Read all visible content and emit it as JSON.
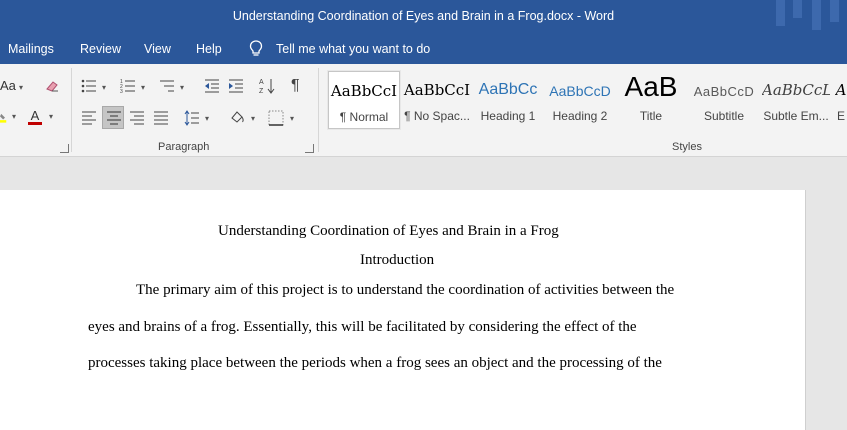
{
  "window": {
    "title": "Understanding Coordination of Eyes and Brain in a Frog.docx  -  Word"
  },
  "menu": {
    "items": [
      "Mailings",
      "Review",
      "View",
      "Help"
    ],
    "tell_me": "Tell me what you want to do"
  },
  "ribbon": {
    "font_fragment": "Aa",
    "paragraph_label": "Paragraph",
    "styles_label": "Styles",
    "styles": [
      {
        "sample": "AaBbCcI",
        "name": "¶ Normal"
      },
      {
        "sample": "AaBbCcI",
        "name": "¶ No Spac..."
      },
      {
        "sample": "AaBbCc",
        "name": "Heading 1"
      },
      {
        "sample": "AaBbCcD",
        "name": "Heading 2"
      },
      {
        "sample": "AaB",
        "name": "Title"
      },
      {
        "sample": "AaBbCcD",
        "name": "Subtitle"
      },
      {
        "sample": "AaBbCcL",
        "name": "Subtle Em..."
      },
      {
        "sample": "A",
        "name": "E"
      }
    ]
  },
  "document": {
    "title": "Understanding Coordination of Eyes and Brain in a Frog",
    "heading": "Introduction",
    "lines": [
      "The primary aim of this project is to understand the coordination of activities between the",
      "eyes and brains of a frog. Essentially, this will be facilitated by considering the effect of the",
      "processes taking place between the periods when a frog sees an object and the processing of the"
    ]
  },
  "colors": {
    "titlebar": "#2b579a",
    "font_color_red": "#c00000",
    "highlight_yellow": "#ffff00",
    "heading_blue": "#2e74b5"
  }
}
